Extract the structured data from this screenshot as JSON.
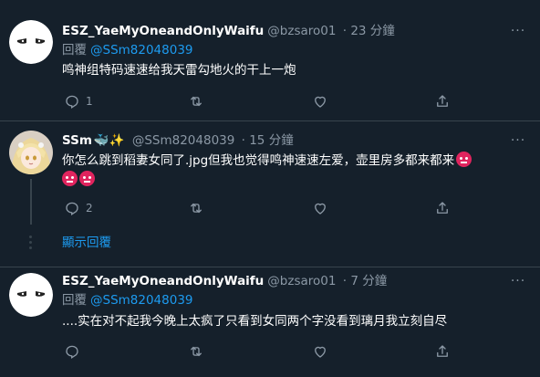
{
  "tweets": [
    {
      "name": "ESZ_YaeMyOneandOnlyWaifu",
      "handle": "@bzsaro01",
      "time": "· 23 分鐘",
      "replying_label": "回覆",
      "replying_to": "@SSm82048039",
      "text": "鸣神组特码速速给我天雷勾地火的干上一炮",
      "reply_count": "1",
      "avatar_icon": "anime-eyes-icon"
    },
    {
      "name": "SSm",
      "name_emojis": [
        "whale-icon",
        "sparkles-icon"
      ],
      "handle": "@SSm82048039",
      "time": "· 15 分鐘",
      "text": "你怎么跳到稻妻女同了.jpg但我也觉得鸣神速速左爱，壶里房多都来都来",
      "reply_count": "2",
      "avatar_icon": "blonde-anime-girl-icon"
    },
    {
      "name": "ESZ_YaeMyOneandOnlyWaifu",
      "handle": "@bzsaro01",
      "time": "· 7 分鐘",
      "replying_label": "回覆",
      "replying_to": "@SSm82048039",
      "text": "....实在对不起我今晚上太疯了只看到女同两个字没看到璃月我立刻自尽",
      "avatar_icon": "anime-eyes-icon"
    }
  ],
  "show_replies_label": "顯示回覆",
  "more_label": "···",
  "colors": {
    "background": "#15202b",
    "text": "#ffffff",
    "muted": "#8b98a5",
    "link": "#1d9bf0",
    "border": "#38444d"
  },
  "action_icons": [
    "reply-icon",
    "retweet-icon",
    "like-icon",
    "share-icon"
  ]
}
